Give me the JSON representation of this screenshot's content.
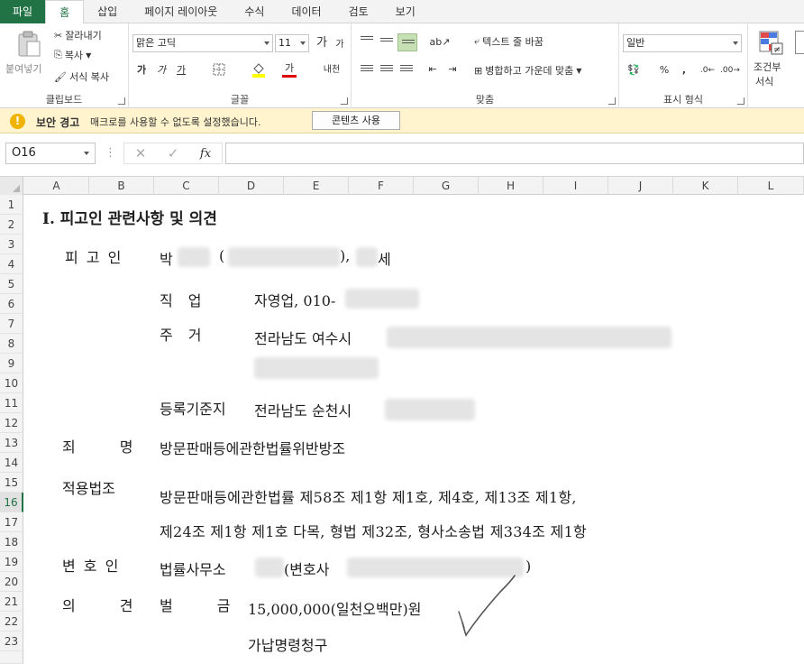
{
  "ribbon_tabs": [
    {
      "label": "파일"
    },
    {
      "label": "홈"
    },
    {
      "label": "삽입"
    },
    {
      "label": "페이지 레이아웃"
    },
    {
      "label": "수식"
    },
    {
      "label": "데이터"
    },
    {
      "label": "검토"
    },
    {
      "label": "보기"
    }
  ],
  "clipboard": {
    "paste_label": "붙여넣기",
    "cut_label": "잘라내기",
    "copy_label": "복사",
    "format_painter_label": "서식 복사",
    "group_label": "클립보드"
  },
  "font": {
    "name": "맑은 고딕",
    "size": "11",
    "grow_label": "가",
    "shrink_label": "가",
    "bold_label": "가",
    "italic_label": "가",
    "underline_label": "가",
    "font_color_label": "가",
    "phonetic_label": "내천",
    "group_label": "글꼴"
  },
  "alignment": {
    "wrap_text_label": "텍스트 줄 바꿈",
    "merge_center_label": "병합하고 가운데 맞춤",
    "group_label": "맞춤"
  },
  "number": {
    "format": "일반",
    "percent_label": "%",
    "comma_label": ",",
    "group_label": "표시 형식"
  },
  "styles": {
    "conditional_label_1": "조건부",
    "conditional_label_2": "서식"
  },
  "security_bar": {
    "title": "보안 경고",
    "message": "매크로를 사용할 수 없도록 설정했습니다.",
    "button_label": "콘텐츠 사용"
  },
  "formula_bar": {
    "name_box": "O16",
    "fx_label": "fx",
    "value": ""
  },
  "columns": [
    "A",
    "B",
    "C",
    "D",
    "E",
    "F",
    "G",
    "H",
    "I",
    "J",
    "K",
    "L"
  ],
  "rows": [
    "1",
    "2",
    "3",
    "4",
    "5",
    "6",
    "7",
    "8",
    "9",
    "10",
    "11",
    "12",
    "13",
    "14",
    "15",
    "16",
    "17",
    "18",
    "19",
    "20",
    "21",
    "22",
    "23"
  ],
  "selected_row": "16",
  "document": {
    "heading": "Ⅰ. 피고인 관련사항 및 의견",
    "defendant_label": "피 고 인",
    "defendant_name_prefix": "박",
    "paren_open": "(",
    "age_sep": "),",
    "age_suffix": "세",
    "job_label": "직 업",
    "job_value": "자영업, 010-",
    "address_label": "주 거",
    "address_value": "전라남도 여수시",
    "registry_label": "등록기준지",
    "registry_value": "전라남도 순천시",
    "crime_label": "죄 명",
    "crime_value": "방문판매등에관한법률위반방조",
    "law_label": "적용법조",
    "law_line1": "방문판매등에관한법률 제58조 제1항 제1호, 제4호, 제13조 제1항,",
    "law_line2": "제24조 제1항 제1호 다목, 형법 제32조, 형사소송법 제334조 제1항",
    "lawyer_label": "변 호 인",
    "lawyer_value": "법률사무소",
    "lawyer_paren": "(변호사",
    "lawyer_close": ")",
    "opinion_label": "의 견",
    "fine_label": "벌 금",
    "fine_value": "15,000,000(일천오백만)원",
    "request_value": "가납명령청구"
  }
}
